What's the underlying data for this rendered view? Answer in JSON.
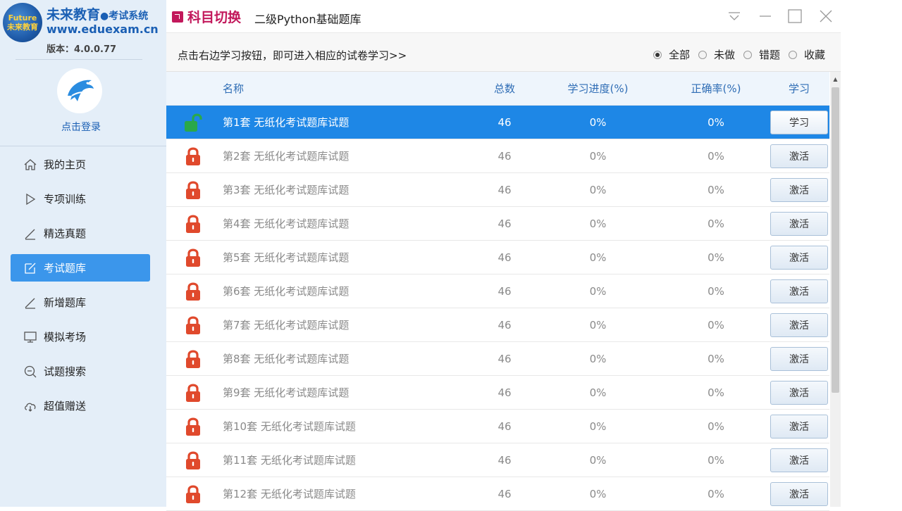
{
  "brand": {
    "title": "未来教育",
    "dot": "●",
    "subtitle": "考试系统",
    "url": "www.eduexam.cn",
    "version": "版本：4.0.0.77",
    "logo_top": "Future",
    "logo_bottom": "未来教育"
  },
  "user": {
    "login_label": "点击登录"
  },
  "nav": {
    "items": [
      {
        "label": "我的主页",
        "icon": "home-icon"
      },
      {
        "label": "专项训练",
        "icon": "play-icon"
      },
      {
        "label": "精选真题",
        "icon": "pen-icon"
      },
      {
        "label": "考试题库",
        "icon": "edit-icon",
        "active": true
      },
      {
        "label": "新增题库",
        "icon": "pen-icon"
      },
      {
        "label": "模拟考场",
        "icon": "monitor-icon"
      },
      {
        "label": "试题搜索",
        "icon": "search-icon"
      },
      {
        "label": "超值赠送",
        "icon": "cloud-icon"
      }
    ]
  },
  "topbar": {
    "switch_label": "科目切换",
    "subject": "二级Python基础题库"
  },
  "instruction": {
    "text": "点击右边学习按钮，即可进入相应的试卷学习>>",
    "filters": [
      {
        "label": "全部",
        "selected": true
      },
      {
        "label": "未做",
        "selected": false
      },
      {
        "label": "错题",
        "selected": false
      },
      {
        "label": "收藏",
        "selected": false
      }
    ]
  },
  "table": {
    "headers": {
      "name": "名称",
      "total": "总数",
      "progress": "学习进度(%)",
      "rate": "正确率(%)",
      "action": "学习"
    },
    "rows": [
      {
        "name": "第1套 无纸化考试题库试题",
        "total": "46",
        "progress": "0%",
        "rate": "0%",
        "action": "学习",
        "locked": false
      },
      {
        "name": "第2套 无纸化考试题库试题",
        "total": "46",
        "progress": "0%",
        "rate": "0%",
        "action": "激活",
        "locked": true
      },
      {
        "name": "第3套 无纸化考试题库试题",
        "total": "46",
        "progress": "0%",
        "rate": "0%",
        "action": "激活",
        "locked": true
      },
      {
        "name": "第4套 无纸化考试题库试题",
        "total": "46",
        "progress": "0%",
        "rate": "0%",
        "action": "激活",
        "locked": true
      },
      {
        "name": "第5套 无纸化考试题库试题",
        "total": "46",
        "progress": "0%",
        "rate": "0%",
        "action": "激活",
        "locked": true
      },
      {
        "name": "第6套 无纸化考试题库试题",
        "total": "46",
        "progress": "0%",
        "rate": "0%",
        "action": "激活",
        "locked": true
      },
      {
        "name": "第7套 无纸化考试题库试题",
        "total": "46",
        "progress": "0%",
        "rate": "0%",
        "action": "激活",
        "locked": true
      },
      {
        "name": "第8套 无纸化考试题库试题",
        "total": "46",
        "progress": "0%",
        "rate": "0%",
        "action": "激活",
        "locked": true
      },
      {
        "name": "第9套 无纸化考试题库试题",
        "total": "46",
        "progress": "0%",
        "rate": "0%",
        "action": "激活",
        "locked": true
      },
      {
        "name": "第10套 无纸化考试题库试题",
        "total": "46",
        "progress": "0%",
        "rate": "0%",
        "action": "激活",
        "locked": true
      },
      {
        "name": "第11套 无纸化考试题库试题",
        "total": "46",
        "progress": "0%",
        "rate": "0%",
        "action": "激活",
        "locked": true
      },
      {
        "name": "第12套 无纸化考试题库试题",
        "total": "46",
        "progress": "0%",
        "rate": "0%",
        "action": "激活",
        "locked": true
      }
    ]
  },
  "colors": {
    "accent": "#1e87e6",
    "nav_active": "#3b96eb",
    "switch": "#c2185b",
    "lock_closed": "#e0492c",
    "lock_open": "#2aa84a"
  }
}
